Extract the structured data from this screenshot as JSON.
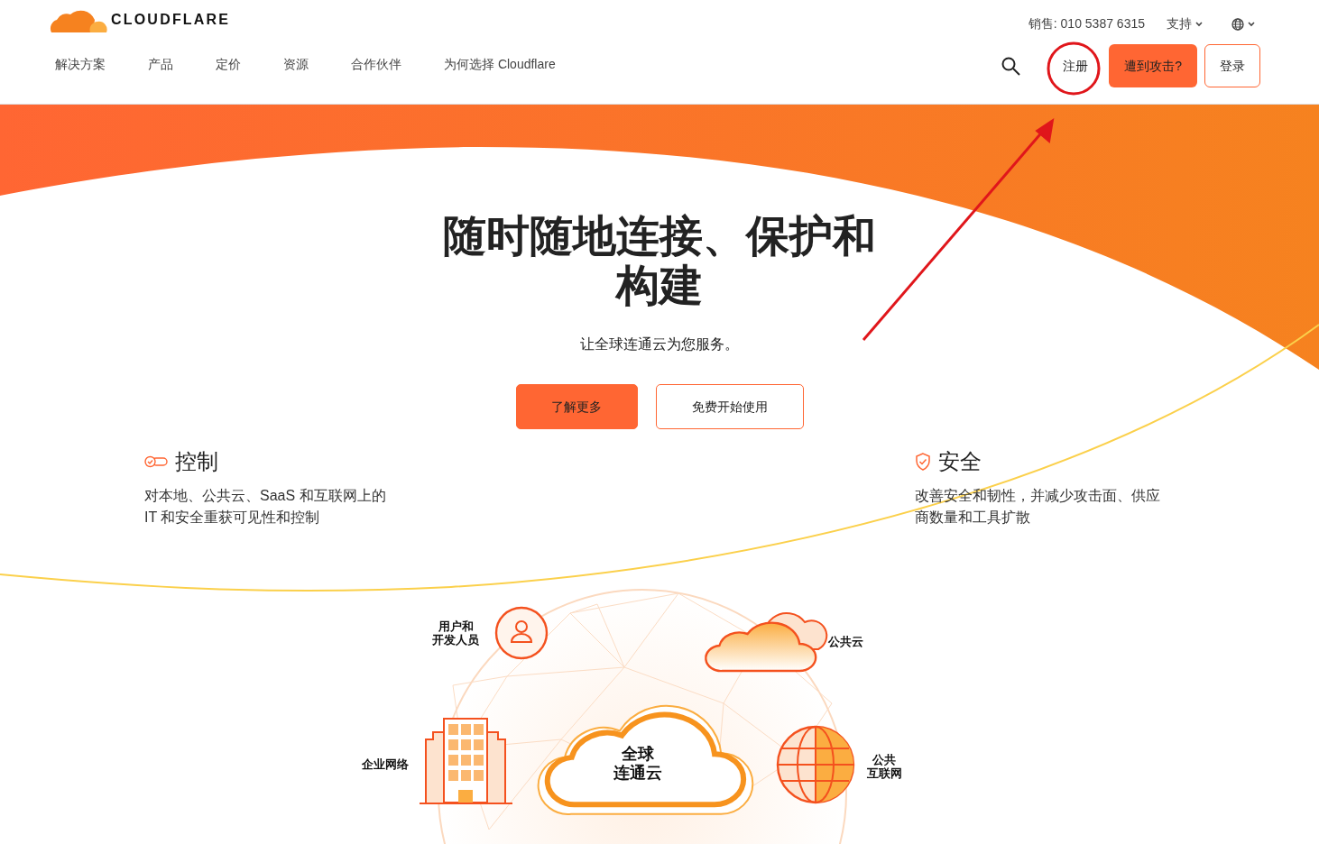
{
  "logo": {
    "text": "CLOUDFLARE"
  },
  "utility": {
    "sales": "销售: 010 5387 6315",
    "support": "支持"
  },
  "nav": [
    {
      "label": "解决方案"
    },
    {
      "label": "产品"
    },
    {
      "label": "定价"
    },
    {
      "label": "资源"
    },
    {
      "label": "合作伙伴"
    },
    {
      "label": "为何选择 Cloudflare"
    }
  ],
  "actions": [
    {
      "label": "注册",
      "kind": "link"
    },
    {
      "label": "遭到攻击?",
      "kind": "primary"
    },
    {
      "label": "登录",
      "kind": "outline"
    }
  ],
  "hero": {
    "title": "随时随地连接、保护和构建",
    "subtitle": "让全球连通云为您服务。",
    "buttons": [
      {
        "label": "了解更多",
        "kind": "primary"
      },
      {
        "label": "免费开始使用",
        "kind": "outline"
      }
    ],
    "features": [
      {
        "title": "控制",
        "text": "对本地、公共云、SaaS 和互联网上的 IT 和安全重获可见性和控制"
      },
      {
        "title": "安全",
        "text": "改善安全和韧性，并减少攻击面、供应商数量和工具扩散"
      }
    ]
  },
  "diagram": {
    "nodes": [
      {
        "kind": "user",
        "label_lines": [
          "用户和",
          "开发人员"
        ]
      },
      {
        "kind": "public_cloud",
        "label_lines": [
          "公共云"
        ]
      },
      {
        "kind": "enterprise",
        "label_lines": [
          "企业网络"
        ]
      },
      {
        "kind": "core",
        "label_lines": [
          "全球",
          "连通云"
        ]
      },
      {
        "kind": "internet",
        "label_lines": [
          "公共",
          "互联网"
        ]
      }
    ]
  }
}
